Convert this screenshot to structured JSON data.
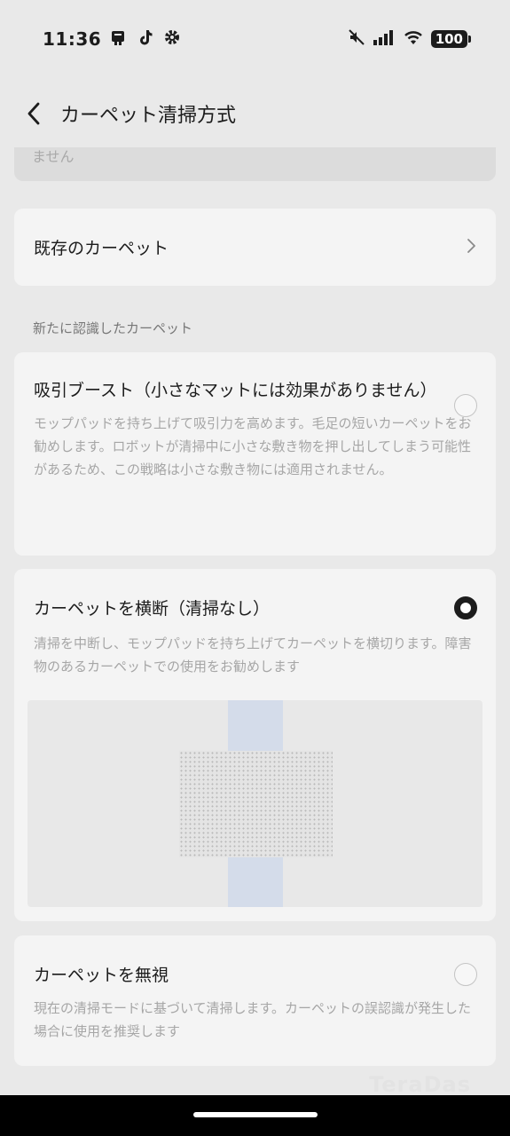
{
  "status_bar": {
    "time": "11:36",
    "battery": "100",
    "left_icons": [
      "notification-icon",
      "tiktok-icon",
      "gear-icon"
    ],
    "right_icons": [
      "mute-icon",
      "signal-icon",
      "wifi-icon",
      "battery-icon"
    ]
  },
  "header": {
    "title": "カーペット清掃方式"
  },
  "partial_text": "ません",
  "existing_carpet": {
    "label": "既存のカーペット"
  },
  "section": {
    "label": "新たに認識したカーペット"
  },
  "options": [
    {
      "title": "吸引ブースト（小さなマットには効果がありません）",
      "description": "モップパッドを持ち上げて吸引力を高めます。毛足の短いカーペットをお勧めします。ロボットが清掃中に小さな敷き物を押し出してしまう可能性があるため、この戦略は小さな敷き物には適用されません。",
      "selected": false
    },
    {
      "title": "カーペットを横断（清掃なし）",
      "description": "清掃を中断し、モップパッドを持ち上げてカーペットを横切ります。障害物のあるカーペットでの使用をお勧めします",
      "selected": true
    },
    {
      "title": "カーペットを無視",
      "description": "現在の清掃モードに基づいて清掃します。カーペットの誤認識が発生した場合に使用を推奨します",
      "selected": false
    }
  ],
  "watermark": "TeraDas",
  "colors": {
    "background": "#e9e9e9",
    "card": "#f4f4f4",
    "path_strip": "#d4dcea",
    "radio_selected": "#1c1c1c"
  }
}
